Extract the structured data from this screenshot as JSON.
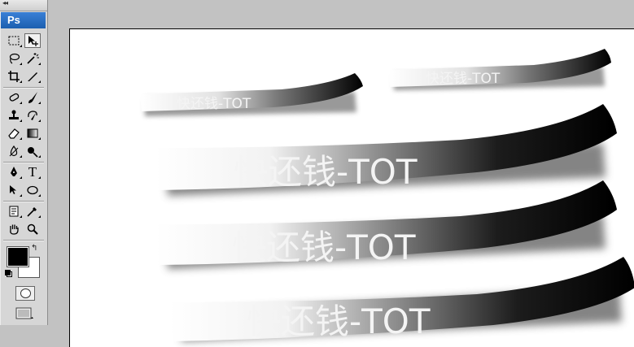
{
  "app": {
    "logo": "Ps"
  },
  "toolbox": {
    "tools": [
      {
        "name": "marquee-tool-icon"
      },
      {
        "name": "move-tool-icon",
        "active": true
      },
      {
        "name": "lasso-tool-icon"
      },
      {
        "name": "magic-wand-tool-icon"
      },
      {
        "name": "crop-tool-icon"
      },
      {
        "name": "slice-tool-icon"
      },
      {
        "name": "healing-brush-tool-icon"
      },
      {
        "name": "brush-tool-icon"
      },
      {
        "name": "clone-stamp-tool-icon"
      },
      {
        "name": "history-brush-tool-icon"
      },
      {
        "name": "eraser-tool-icon"
      },
      {
        "name": "gradient-tool-icon"
      },
      {
        "name": "blur-tool-icon"
      },
      {
        "name": "dodge-tool-icon"
      },
      {
        "name": "pen-tool-icon"
      },
      {
        "name": "type-tool-icon"
      },
      {
        "name": "path-selection-tool-icon"
      },
      {
        "name": "ellipse-tool-icon"
      },
      {
        "name": "notes-tool-icon"
      },
      {
        "name": "eyedropper-tool-icon"
      },
      {
        "name": "hand-tool-icon"
      },
      {
        "name": "zoom-tool-icon"
      }
    ],
    "type_tool_glyph": "T",
    "foreground_color": "#000000",
    "background_color": "#ffffff"
  },
  "canvas": {
    "background": "#ffffff",
    "brush_strokes": [
      {
        "text": "快还钱-TOT"
      },
      {
        "text": "快还钱-TOT"
      },
      {
        "text": "快还钱-TOT"
      },
      {
        "text": "快还钱-TOT"
      },
      {
        "text": "快还钱-TOT"
      }
    ]
  }
}
